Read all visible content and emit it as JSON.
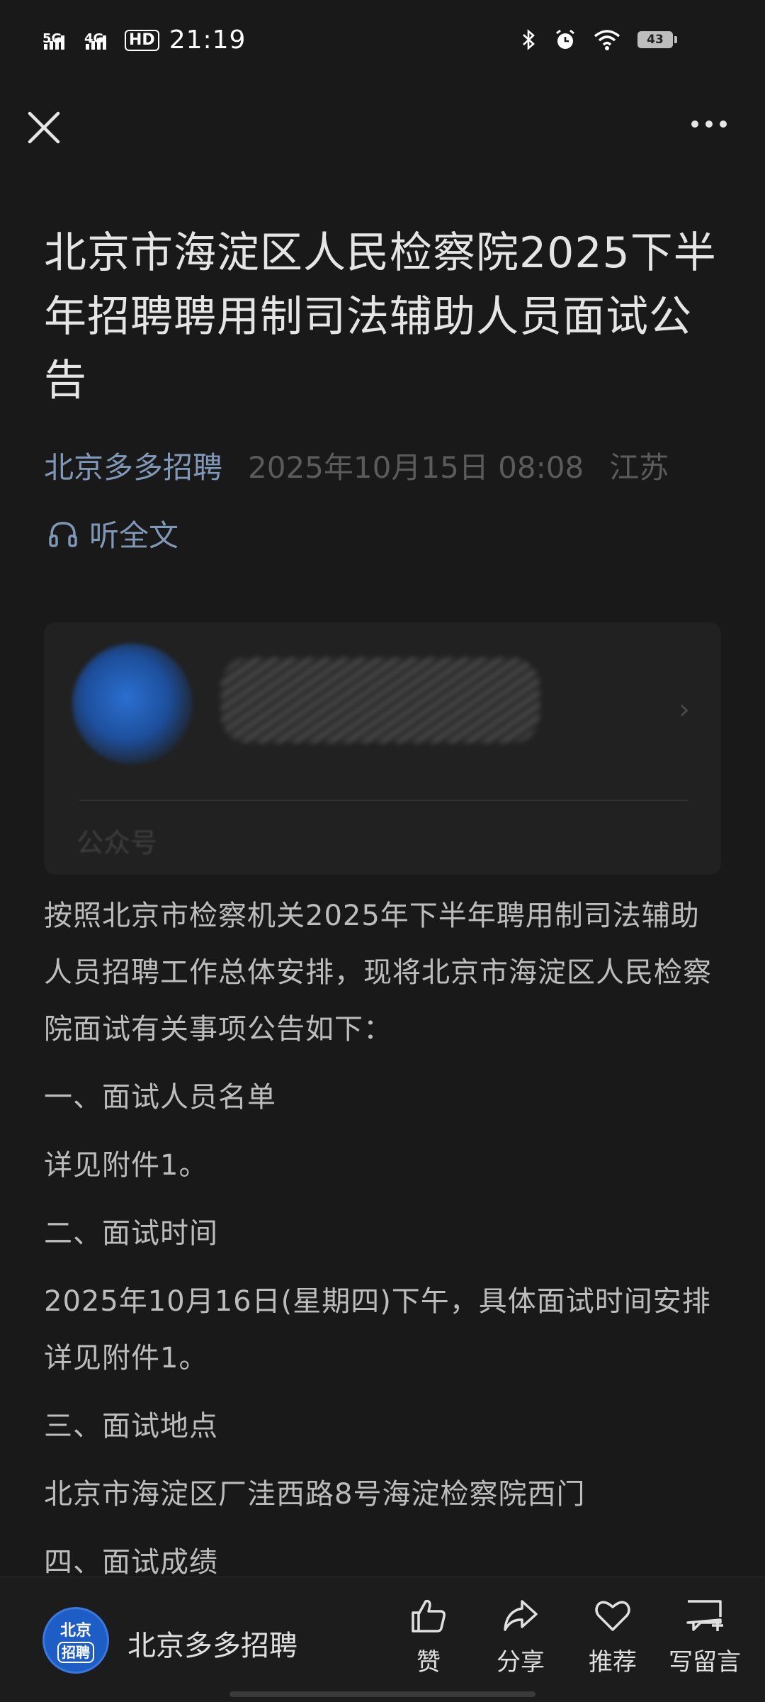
{
  "status_bar": {
    "net1": "5G",
    "net2": "4G",
    "hd": "HD",
    "time": "21:19",
    "battery": "43"
  },
  "article": {
    "title": "北京市海淀区人民检察院2025下半年招聘聘用制司法辅助人员面试公告",
    "author": "北京多多招聘",
    "date": "2025年10月15日 08:08",
    "location": "江苏",
    "listen_label": "听全文"
  },
  "card": {
    "tag": "公众号"
  },
  "body": [
    "按照北京市检察机关2025年下半年聘用制司法辅助人员招聘工作总体安排，现将北京市海淀区人民检察院面试有关事项公告如下：",
    "一、面试人员名单",
    "详见附件1。",
    "二、面试时间",
    "2025年10月16日(星期四)下午，具体面试时间安排详见附件1。",
    "三、面试地点",
    "北京市海淀区厂洼西路8号海淀检察院西门",
    "四、面试成绩"
  ],
  "bottom_bar": {
    "avatar_top": "北京",
    "avatar_bottom": "招聘",
    "name": "北京多多招聘",
    "actions": [
      {
        "label": "赞",
        "icon": "thumbs-up-icon"
      },
      {
        "label": "分享",
        "icon": "share-icon"
      },
      {
        "label": "推荐",
        "icon": "heart-icon"
      },
      {
        "label": "写留言",
        "icon": "comment-icon"
      }
    ]
  }
}
